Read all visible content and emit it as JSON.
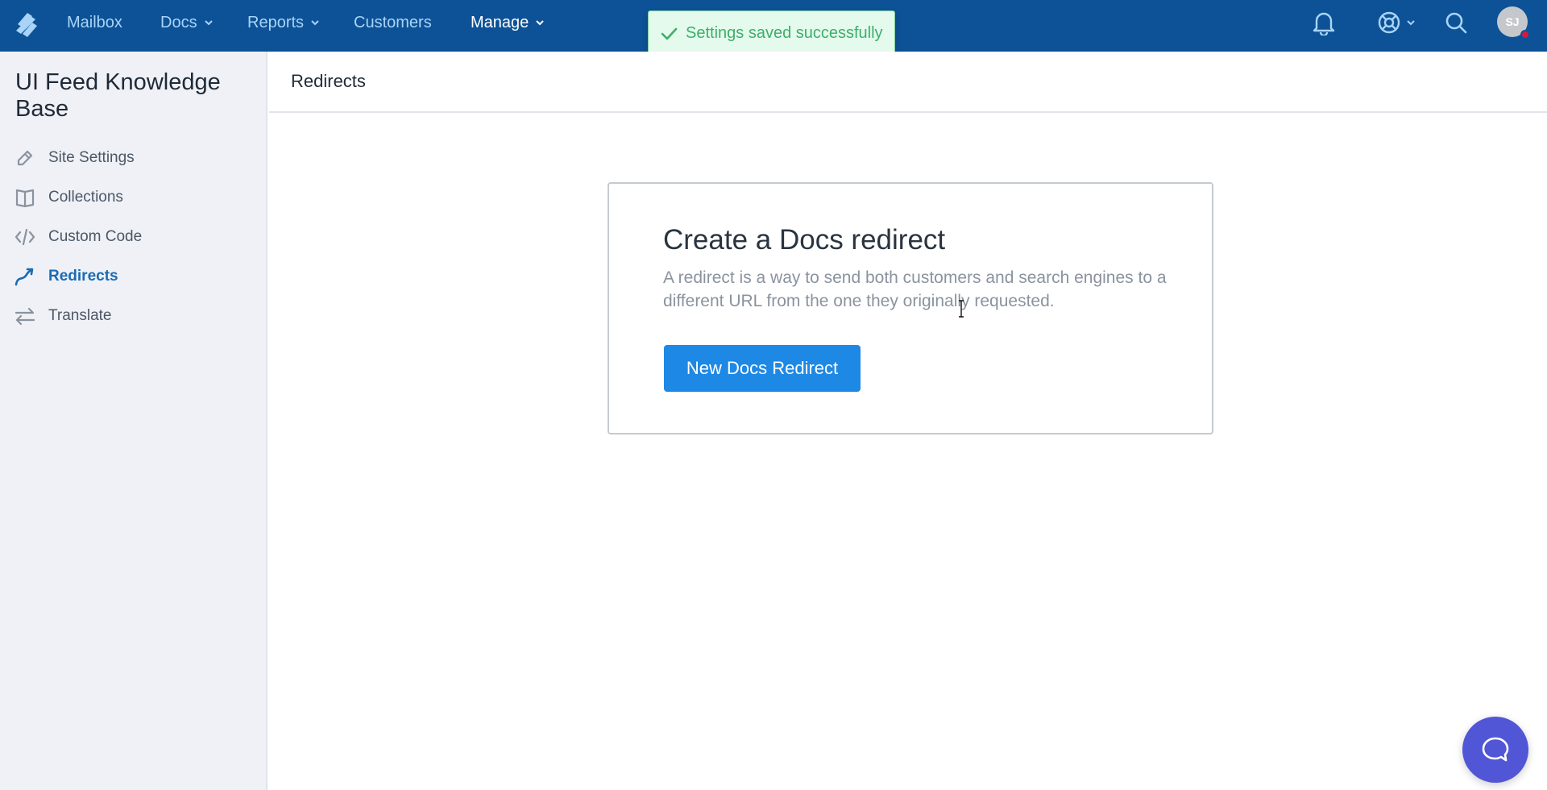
{
  "topbar": {
    "logo_icon": "helpscout-logo",
    "nav": [
      {
        "label": "Mailbox",
        "has_dropdown": false,
        "active": false
      },
      {
        "label": "Docs",
        "has_dropdown": true,
        "active": false
      },
      {
        "label": "Reports",
        "has_dropdown": true,
        "active": false
      },
      {
        "label": "Customers",
        "has_dropdown": false,
        "active": false
      },
      {
        "label": "Manage",
        "has_dropdown": true,
        "active": true
      }
    ],
    "icons": [
      "bell-icon",
      "help-lifebuoy-icon",
      "search-icon"
    ],
    "avatar_initials": "SJ",
    "avatar_status_color": "#d7193e",
    "brand_color": "#0d5296"
  },
  "toast": {
    "icon": "check-icon",
    "message": "Settings saved successfully",
    "color": "#3fae6a"
  },
  "sidebar": {
    "title": "UI Feed Knowledge Base",
    "items": [
      {
        "label": "Site Settings",
        "icon": "pencil-icon",
        "active": false
      },
      {
        "label": "Collections",
        "icon": "book-icon",
        "active": false
      },
      {
        "label": "Custom Code",
        "icon": "code-icon",
        "active": false
      },
      {
        "label": "Redirects",
        "icon": "redirect-arrow-icon",
        "active": true
      },
      {
        "label": "Translate",
        "icon": "swap-arrows-icon",
        "active": false
      }
    ]
  },
  "main": {
    "header_title": "Redirects",
    "card": {
      "heading": "Create a Docs redirect",
      "description": "A redirect is a way to send both customers and search engines to a different URL from the one they originally requested.",
      "button_label": "New Docs Redirect",
      "button_color": "#1e88e5"
    }
  },
  "chat_widget": {
    "icon": "chat-bubble-icon",
    "color": "#5156d6"
  }
}
